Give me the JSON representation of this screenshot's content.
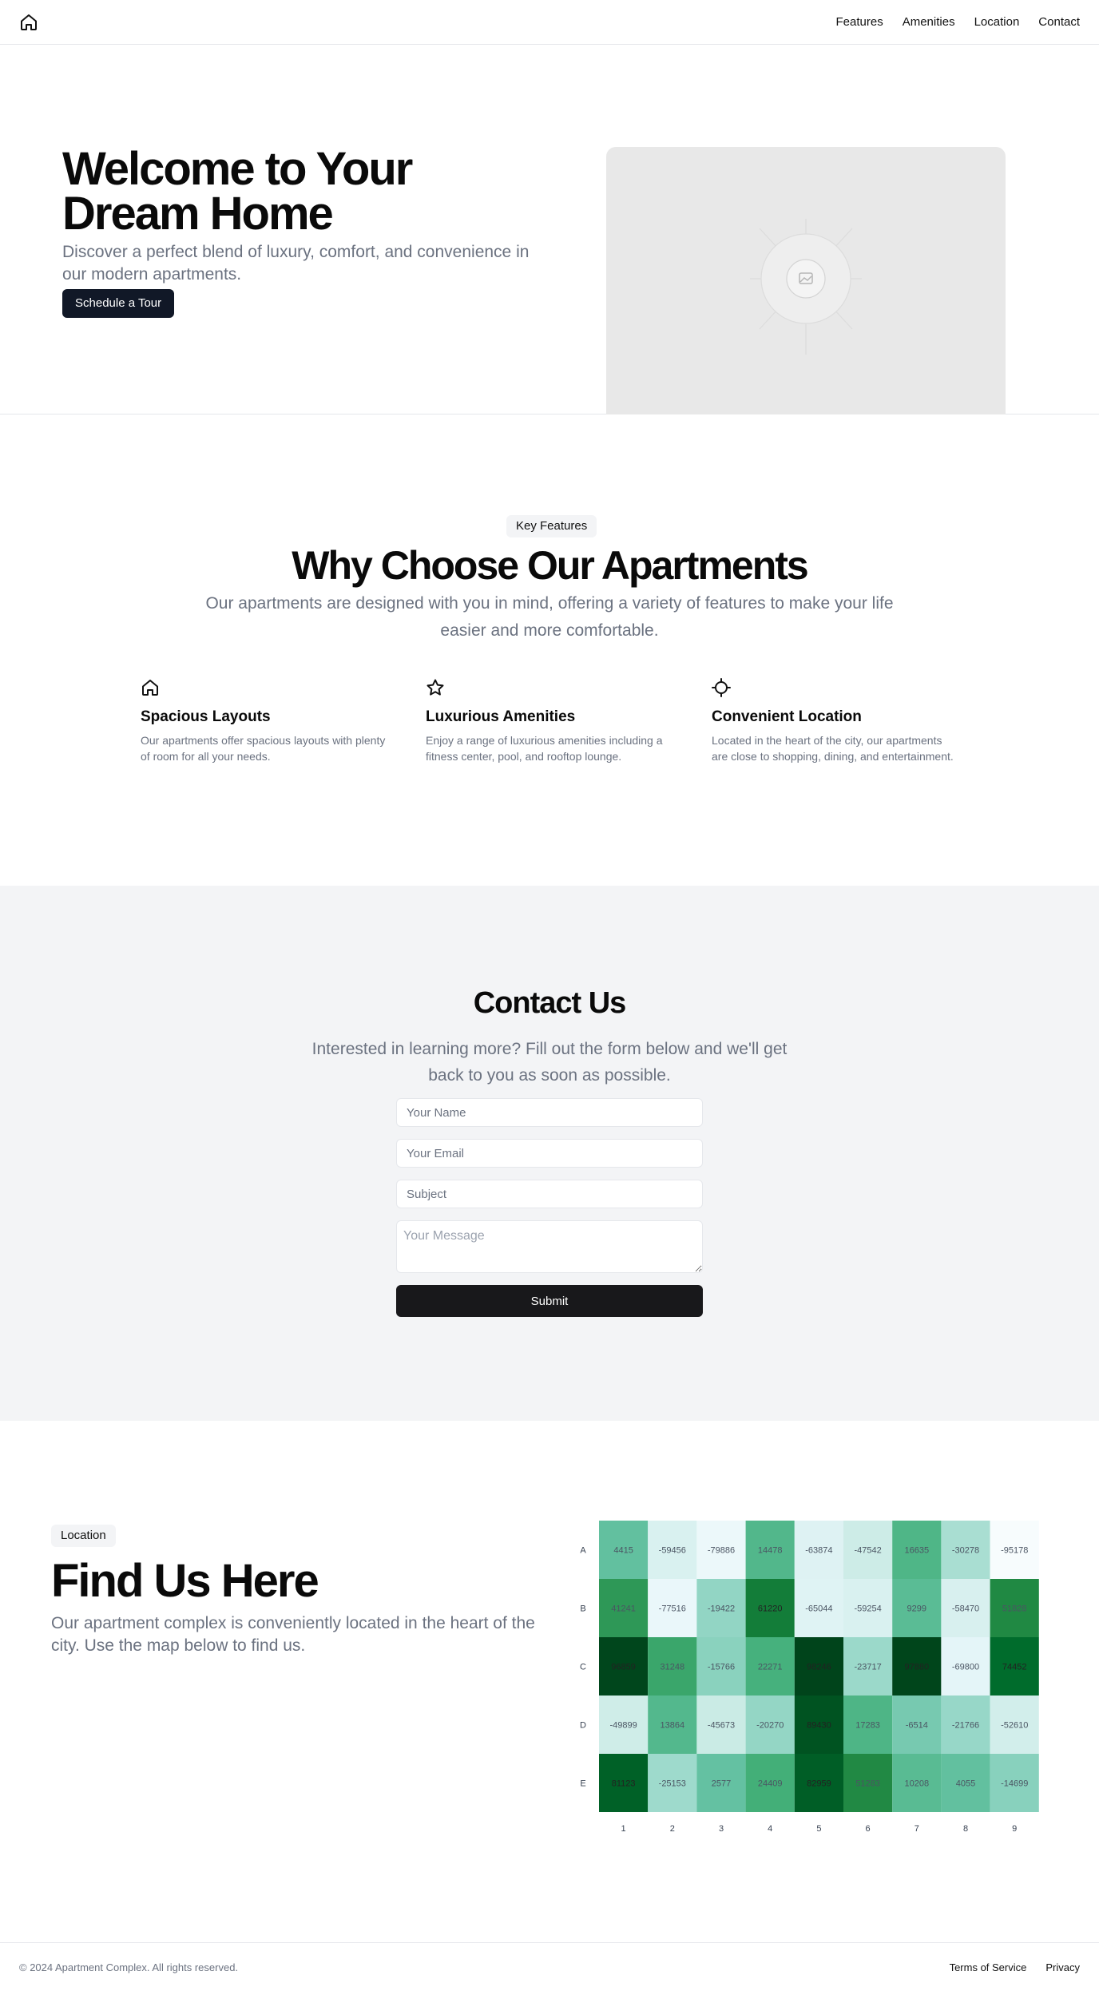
{
  "header": {
    "logo_icon": "home-icon",
    "nav": [
      "Features",
      "Amenities",
      "Location",
      "Contact"
    ]
  },
  "hero": {
    "title": "Welcome to Your Dream Home",
    "subtitle": "Discover a perfect blend of luxury, comfort, and convenience in our modern apartments.",
    "cta": "Schedule a Tour",
    "image_icon": "image-placeholder-icon"
  },
  "features": {
    "badge": "Key Features",
    "title": "Why Choose Our Apartments",
    "subtitle": "Our apartments are designed with you in mind, offering a variety of features to make your life easier and more comfortable.",
    "items": [
      {
        "icon": "home-icon",
        "title": "Spacious Layouts",
        "text": "Our apartments offer spacious layouts with plenty of room for all your needs."
      },
      {
        "icon": "star-icon",
        "title": "Luxurious Amenities",
        "text": "Enjoy a range of luxurious amenities including a fitness center, pool, and rooftop lounge."
      },
      {
        "icon": "crosshair-icon",
        "title": "Convenient Location",
        "text": "Located in the heart of the city, our apartments are close to shopping, dining, and entertainment."
      }
    ]
  },
  "contact": {
    "title": "Contact Us",
    "subtitle": "Interested in learning more? Fill out the form below and we'll get back to you as soon as possible.",
    "name_placeholder": "Your Name",
    "email_placeholder": "Your Email",
    "subject_placeholder": "Subject",
    "message_placeholder": "Your Message",
    "submit": "Submit"
  },
  "location": {
    "badge": "Location",
    "title": "Find Us Here",
    "subtitle": "Our apartment complex is conveniently located in the heart of the city. Use the map below to find us."
  },
  "chart_data": {
    "type": "heatmap",
    "rows": [
      "A",
      "B",
      "C",
      "D",
      "E"
    ],
    "columns": [
      "1",
      "2",
      "3",
      "4",
      "5",
      "6",
      "7",
      "8",
      "9"
    ],
    "values": [
      [
        4415,
        -59456,
        -79886,
        14478,
        -63874,
        -47542,
        16635,
        -30278,
        -95178
      ],
      [
        41241,
        -77516,
        -19422,
        61220,
        -65044,
        -59254,
        9299,
        -58470,
        51828
      ],
      [
        96859,
        31248,
        -15766,
        22271,
        98246,
        -23717,
        97880,
        -69800,
        74452
      ],
      [
        -49899,
        13864,
        -45673,
        -20270,
        89430,
        17283,
        -6514,
        -21766,
        -52610
      ],
      [
        81123,
        -25153,
        2577,
        24409,
        82959,
        51283,
        10208,
        4055,
        -14699
      ]
    ],
    "color_scale": "greens",
    "colorbar": false
  },
  "footer": {
    "copyright": "© 2024 Apartment Complex. All rights reserved.",
    "links": [
      "Terms of Service",
      "Privacy"
    ]
  }
}
